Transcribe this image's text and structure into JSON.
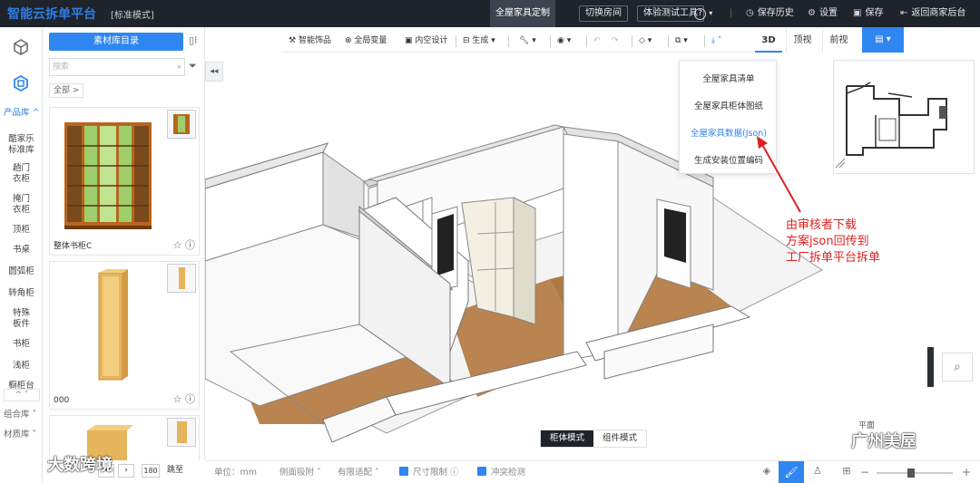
{
  "topbar": {
    "logo": "智能云拆单平台",
    "mode": "[标准模式]",
    "active_tab": "全屋家具定制",
    "switch_room": "切换房间",
    "experience": "体验测试工具",
    "save_history": "保存历史",
    "settings": "设置",
    "save": "保存",
    "return": "返回商家后台"
  },
  "rail": {
    "product_lib": "产品库",
    "categories": [
      "酷家乐\n标准库",
      "趟门\n衣柜",
      "掩门\n衣柜",
      "顶柜",
      "书桌",
      "圆弧柜",
      "转角柜",
      "特殊\n板件",
      "书柜",
      "浅柜",
      "橱柜台"
    ],
    "combo_lib": "组合库",
    "material_lib": "材质库"
  },
  "panel": {
    "material_catalog": "素材库目录",
    "search_placeholder": "搜索",
    "breadcrumb": "全部 >",
    "items": [
      {
        "name": "整体书柜C"
      },
      {
        "name": "000"
      },
      {
        "name": ""
      }
    ],
    "pager_value": "180",
    "pager_go": "跳至"
  },
  "toolbar": {
    "smart_decor": "智能饰品",
    "global_vars": "全局变量",
    "interior_design": "内空设计",
    "generate": "生成",
    "tools": "",
    "view": "",
    "tab_3d": "3D",
    "tab_top": "顶视",
    "tab_front": "前视"
  },
  "dropdown": {
    "items": [
      "全屋家具清单",
      "全屋家具柜体图纸",
      "全屋家具数据(Json)",
      "生成安装位置编码"
    ],
    "highlight_color": "#2f86f0"
  },
  "annotation": {
    "lines": [
      "由审核者下载",
      "方案json回传到",
      "工厂拆单平台拆单"
    ],
    "color": "#e02020"
  },
  "canvas_mode": {
    "cabinet_mode": "柜体模式",
    "component_mode": "组件模式"
  },
  "statusbar": {
    "unit": "单位：mm",
    "side_adsorb": "侧面吸附",
    "limited_adapt": "有限适配",
    "size_limit": "尺寸限制",
    "collision": "冲突检测"
  },
  "overlay": {
    "view_label": "平面",
    "watermark_right": "广州美屋",
    "watermark_left": "大数跨境"
  },
  "colors": {
    "accent": "#2f86f0",
    "topbar_bg": "#1f232b",
    "floor": "#b9844f"
  }
}
